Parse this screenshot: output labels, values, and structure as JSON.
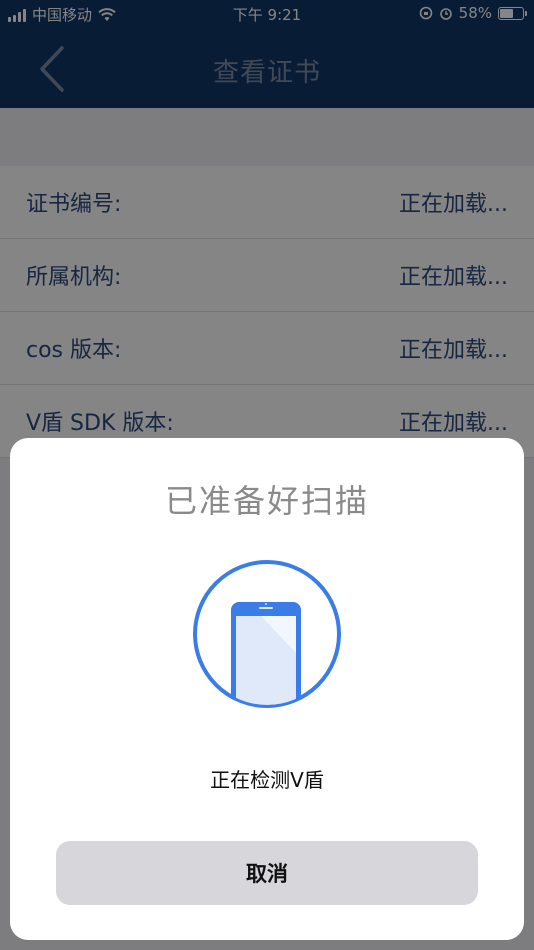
{
  "status_bar": {
    "carrier": "中国移动",
    "time": "下午 9:21",
    "battery": "58%",
    "battery_level": 0.58
  },
  "nav": {
    "title": "查看证书"
  },
  "rows": [
    {
      "label": "证书编号:",
      "value": "正在加载..."
    },
    {
      "label": "所属机构:",
      "value": "正在加载..."
    },
    {
      "label": "cos 版本:",
      "value": "正在加载..."
    },
    {
      "label": "V盾 SDK 版本:",
      "value": "正在加载..."
    }
  ],
  "sheet": {
    "title": "已准备好扫描",
    "status": "正在检测V盾",
    "cancel_label": "取消"
  },
  "colors": {
    "nav_bg": "#133769",
    "accent_blue": "#3a7de6",
    "sheet_button_bg": "#d6d6db"
  }
}
